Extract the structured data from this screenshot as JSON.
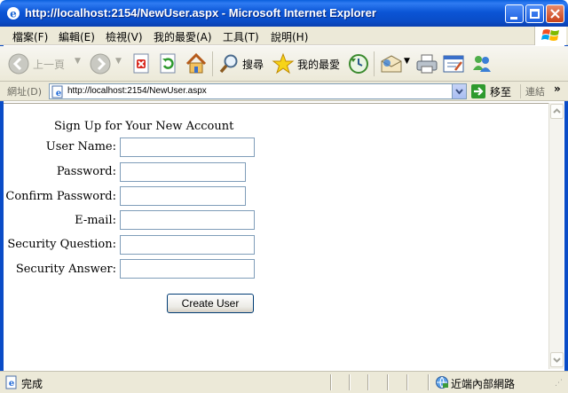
{
  "window": {
    "title": "http://localhost:2154/NewUser.aspx - Microsoft Internet Explorer"
  },
  "menu": {
    "items": [
      "檔案(F)",
      "編輯(E)",
      "檢視(V)",
      "我的最愛(A)",
      "工具(T)",
      "說明(H)"
    ]
  },
  "toolbar": {
    "back_label": "上一頁",
    "search_label": "搜尋",
    "favorites_label": "我的最愛"
  },
  "address": {
    "label": "網址(D)",
    "url": "http://localhost:2154/NewUser.aspx",
    "go_label": "移至",
    "links_label": "連結",
    "links_more": "»"
  },
  "form": {
    "title": "Sign Up for Your New Account",
    "fields": [
      {
        "label": "User Name:",
        "value": ""
      },
      {
        "label": "Password:",
        "value": ""
      },
      {
        "label": "Confirm Password:",
        "value": ""
      },
      {
        "label": "E-mail:",
        "value": ""
      },
      {
        "label": "Security Question:",
        "value": ""
      },
      {
        "label": "Security Answer:",
        "value": ""
      }
    ],
    "submit_label": "Create User"
  },
  "status": {
    "text": "完成",
    "zone": "近端內部網路"
  },
  "colors": {
    "titlebar": "#0a4cc7",
    "chrome": "#ece9d8",
    "input_border": "#7f9db9"
  }
}
